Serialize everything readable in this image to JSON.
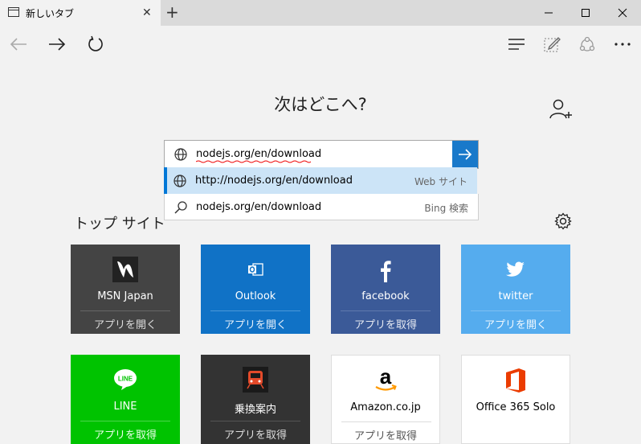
{
  "tab": {
    "title": "新しいタブ",
    "close": "✕"
  },
  "new_tab": "+",
  "page": {
    "headline": "次はどこへ?",
    "search": {
      "value": "nodejs.org/en/download",
      "suggestions": [
        {
          "text": "http://nodejs.org/en/download",
          "type": "Web サイト",
          "icon": "globe-icon"
        },
        {
          "text": "nodejs.org/en/download",
          "type": "Bing 検索",
          "icon": "search-icon"
        }
      ]
    },
    "top_sites_title": "トップ サイト",
    "sites": [
      {
        "name": "MSN Japan",
        "action": "アプリを開く",
        "bg": "#444444",
        "fg": "#ffffff"
      },
      {
        "name": "Outlook",
        "action": "アプリを開く",
        "bg": "#1072c6",
        "fg": "#ffffff"
      },
      {
        "name": "facebook",
        "action": "アプリを取得",
        "bg": "#3b5a98",
        "fg": "#ffffff"
      },
      {
        "name": "twitter",
        "action": "アプリを開く",
        "bg": "#55acee",
        "fg": "#ffffff"
      },
      {
        "name": "LINE",
        "action": "アプリを取得",
        "bg": "#00c300",
        "fg": "#ffffff"
      },
      {
        "name": "乗換案内",
        "action": "アプリを取得",
        "bg": "#333333",
        "fg": "#ffffff"
      },
      {
        "name": "Amazon.co.jp",
        "action": "アプリを取得",
        "bg": "#ffffff",
        "fg": "#000000"
      },
      {
        "name": "Office 365 Solo",
        "action": "",
        "bg": "#ffffff",
        "fg": "#000000"
      }
    ]
  },
  "colors": {
    "accent": "#0078d7",
    "go_button": "#1979ca",
    "suggestion_highlight": "#cce4f7"
  }
}
